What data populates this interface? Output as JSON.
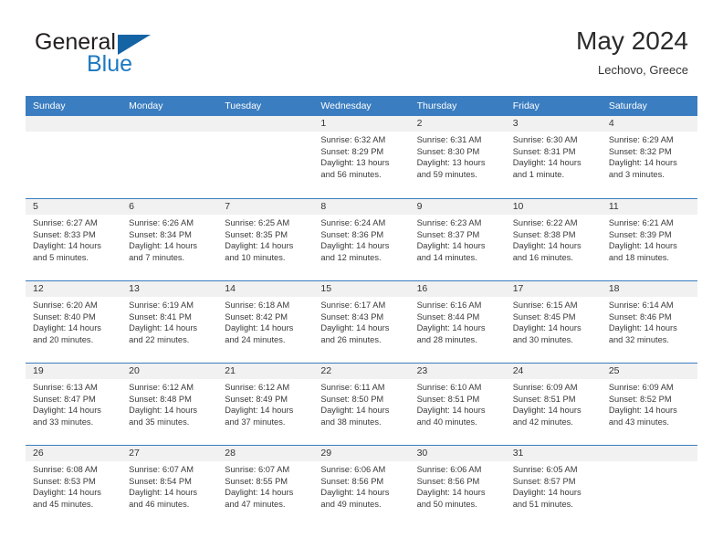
{
  "logo": {
    "word1": "General",
    "word2": "Blue",
    "triangle_color": "#1463a5",
    "blue_color": "#1b79c2"
  },
  "header": {
    "title": "May 2024",
    "location": "Lechovo, Greece"
  },
  "theme": {
    "header_bar_color": "#3a7dc0",
    "day_number_bg": "#f1f1f1",
    "text_color": "#3a3a3a"
  },
  "weekdays": [
    "Sunday",
    "Monday",
    "Tuesday",
    "Wednesday",
    "Thursday",
    "Friday",
    "Saturday"
  ],
  "weeks": [
    [
      {
        "day": "",
        "sunrise": "",
        "sunset": "",
        "daylight1": "",
        "daylight2": ""
      },
      {
        "day": "",
        "sunrise": "",
        "sunset": "",
        "daylight1": "",
        "daylight2": ""
      },
      {
        "day": "",
        "sunrise": "",
        "sunset": "",
        "daylight1": "",
        "daylight2": ""
      },
      {
        "day": "1",
        "sunrise": "Sunrise: 6:32 AM",
        "sunset": "Sunset: 8:29 PM",
        "daylight1": "Daylight: 13 hours",
        "daylight2": "and 56 minutes."
      },
      {
        "day": "2",
        "sunrise": "Sunrise: 6:31 AM",
        "sunset": "Sunset: 8:30 PM",
        "daylight1": "Daylight: 13 hours",
        "daylight2": "and 59 minutes."
      },
      {
        "day": "3",
        "sunrise": "Sunrise: 6:30 AM",
        "sunset": "Sunset: 8:31 PM",
        "daylight1": "Daylight: 14 hours",
        "daylight2": "and 1 minute."
      },
      {
        "day": "4",
        "sunrise": "Sunrise: 6:29 AM",
        "sunset": "Sunset: 8:32 PM",
        "daylight1": "Daylight: 14 hours",
        "daylight2": "and 3 minutes."
      }
    ],
    [
      {
        "day": "5",
        "sunrise": "Sunrise: 6:27 AM",
        "sunset": "Sunset: 8:33 PM",
        "daylight1": "Daylight: 14 hours",
        "daylight2": "and 5 minutes."
      },
      {
        "day": "6",
        "sunrise": "Sunrise: 6:26 AM",
        "sunset": "Sunset: 8:34 PM",
        "daylight1": "Daylight: 14 hours",
        "daylight2": "and 7 minutes."
      },
      {
        "day": "7",
        "sunrise": "Sunrise: 6:25 AM",
        "sunset": "Sunset: 8:35 PM",
        "daylight1": "Daylight: 14 hours",
        "daylight2": "and 10 minutes."
      },
      {
        "day": "8",
        "sunrise": "Sunrise: 6:24 AM",
        "sunset": "Sunset: 8:36 PM",
        "daylight1": "Daylight: 14 hours",
        "daylight2": "and 12 minutes."
      },
      {
        "day": "9",
        "sunrise": "Sunrise: 6:23 AM",
        "sunset": "Sunset: 8:37 PM",
        "daylight1": "Daylight: 14 hours",
        "daylight2": "and 14 minutes."
      },
      {
        "day": "10",
        "sunrise": "Sunrise: 6:22 AM",
        "sunset": "Sunset: 8:38 PM",
        "daylight1": "Daylight: 14 hours",
        "daylight2": "and 16 minutes."
      },
      {
        "day": "11",
        "sunrise": "Sunrise: 6:21 AM",
        "sunset": "Sunset: 8:39 PM",
        "daylight1": "Daylight: 14 hours",
        "daylight2": "and 18 minutes."
      }
    ],
    [
      {
        "day": "12",
        "sunrise": "Sunrise: 6:20 AM",
        "sunset": "Sunset: 8:40 PM",
        "daylight1": "Daylight: 14 hours",
        "daylight2": "and 20 minutes."
      },
      {
        "day": "13",
        "sunrise": "Sunrise: 6:19 AM",
        "sunset": "Sunset: 8:41 PM",
        "daylight1": "Daylight: 14 hours",
        "daylight2": "and 22 minutes."
      },
      {
        "day": "14",
        "sunrise": "Sunrise: 6:18 AM",
        "sunset": "Sunset: 8:42 PM",
        "daylight1": "Daylight: 14 hours",
        "daylight2": "and 24 minutes."
      },
      {
        "day": "15",
        "sunrise": "Sunrise: 6:17 AM",
        "sunset": "Sunset: 8:43 PM",
        "daylight1": "Daylight: 14 hours",
        "daylight2": "and 26 minutes."
      },
      {
        "day": "16",
        "sunrise": "Sunrise: 6:16 AM",
        "sunset": "Sunset: 8:44 PM",
        "daylight1": "Daylight: 14 hours",
        "daylight2": "and 28 minutes."
      },
      {
        "day": "17",
        "sunrise": "Sunrise: 6:15 AM",
        "sunset": "Sunset: 8:45 PM",
        "daylight1": "Daylight: 14 hours",
        "daylight2": "and 30 minutes."
      },
      {
        "day": "18",
        "sunrise": "Sunrise: 6:14 AM",
        "sunset": "Sunset: 8:46 PM",
        "daylight1": "Daylight: 14 hours",
        "daylight2": "and 32 minutes."
      }
    ],
    [
      {
        "day": "19",
        "sunrise": "Sunrise: 6:13 AM",
        "sunset": "Sunset: 8:47 PM",
        "daylight1": "Daylight: 14 hours",
        "daylight2": "and 33 minutes."
      },
      {
        "day": "20",
        "sunrise": "Sunrise: 6:12 AM",
        "sunset": "Sunset: 8:48 PM",
        "daylight1": "Daylight: 14 hours",
        "daylight2": "and 35 minutes."
      },
      {
        "day": "21",
        "sunrise": "Sunrise: 6:12 AM",
        "sunset": "Sunset: 8:49 PM",
        "daylight1": "Daylight: 14 hours",
        "daylight2": "and 37 minutes."
      },
      {
        "day": "22",
        "sunrise": "Sunrise: 6:11 AM",
        "sunset": "Sunset: 8:50 PM",
        "daylight1": "Daylight: 14 hours",
        "daylight2": "and 38 minutes."
      },
      {
        "day": "23",
        "sunrise": "Sunrise: 6:10 AM",
        "sunset": "Sunset: 8:51 PM",
        "daylight1": "Daylight: 14 hours",
        "daylight2": "and 40 minutes."
      },
      {
        "day": "24",
        "sunrise": "Sunrise: 6:09 AM",
        "sunset": "Sunset: 8:51 PM",
        "daylight1": "Daylight: 14 hours",
        "daylight2": "and 42 minutes."
      },
      {
        "day": "25",
        "sunrise": "Sunrise: 6:09 AM",
        "sunset": "Sunset: 8:52 PM",
        "daylight1": "Daylight: 14 hours",
        "daylight2": "and 43 minutes."
      }
    ],
    [
      {
        "day": "26",
        "sunrise": "Sunrise: 6:08 AM",
        "sunset": "Sunset: 8:53 PM",
        "daylight1": "Daylight: 14 hours",
        "daylight2": "and 45 minutes."
      },
      {
        "day": "27",
        "sunrise": "Sunrise: 6:07 AM",
        "sunset": "Sunset: 8:54 PM",
        "daylight1": "Daylight: 14 hours",
        "daylight2": "and 46 minutes."
      },
      {
        "day": "28",
        "sunrise": "Sunrise: 6:07 AM",
        "sunset": "Sunset: 8:55 PM",
        "daylight1": "Daylight: 14 hours",
        "daylight2": "and 47 minutes."
      },
      {
        "day": "29",
        "sunrise": "Sunrise: 6:06 AM",
        "sunset": "Sunset: 8:56 PM",
        "daylight1": "Daylight: 14 hours",
        "daylight2": "and 49 minutes."
      },
      {
        "day": "30",
        "sunrise": "Sunrise: 6:06 AM",
        "sunset": "Sunset: 8:56 PM",
        "daylight1": "Daylight: 14 hours",
        "daylight2": "and 50 minutes."
      },
      {
        "day": "31",
        "sunrise": "Sunrise: 6:05 AM",
        "sunset": "Sunset: 8:57 PM",
        "daylight1": "Daylight: 14 hours",
        "daylight2": "and 51 minutes."
      },
      {
        "day": "",
        "sunrise": "",
        "sunset": "",
        "daylight1": "",
        "daylight2": ""
      }
    ]
  ]
}
